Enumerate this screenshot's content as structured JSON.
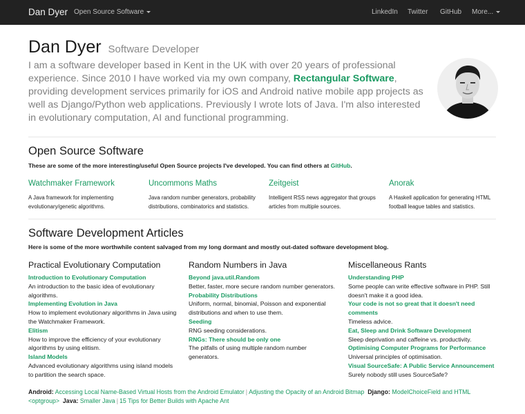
{
  "nav": {
    "brand": "Dan Dyer",
    "dropdown": "Open Source Software",
    "right": [
      "LinkedIn",
      "Twitter",
      "GitHub"
    ],
    "more": "More..."
  },
  "hero": {
    "name": "Dan Dyer",
    "subtitle": "Software Developer",
    "intro_before": "I am a software developer based in Kent in the UK with over 20 years of professional experience. Since 2010 I have worked via my own company, ",
    "intro_company": "Rectangular Software",
    "intro_after": ", providing development services primarily for iOS and Android native mobile app projects as well as Django/Python web applications. Previously I wrote lots of Java. I'm also interested in evolutionary computation, AI and functional programming."
  },
  "oss": {
    "heading": "Open Source Software",
    "lead_before": "These are some of the more interesting/useful Open Source projects I've developed. You can find others at ",
    "lead_link": "GitHub",
    "lead_after": ".",
    "projects": [
      {
        "title": "Watchmaker Framework",
        "desc": "A Java framework for implementing evolutionary/genetic algorithms."
      },
      {
        "title": "Uncommons Maths",
        "desc": "Java random number generators, probability distributions, combinatorics and statistics."
      },
      {
        "title": "Zeitgeist",
        "desc": "Intelligent RSS news aggregator that groups articles from multiple sources."
      },
      {
        "title": "Anorak",
        "desc": "A Haskell application for generating HTML football league tables and statistics."
      }
    ]
  },
  "articles": {
    "heading": "Software Development Articles",
    "lead": "Here is some of the more worthwhile content salvaged from my long dormant and mostly out-dated software development blog.",
    "columns": [
      {
        "title": "Practical Evolutionary Computation",
        "items": [
          {
            "link": "Introduction to Evolutionary Computation",
            "desc": "An introduction to the basic idea of evolutionary algorithms."
          },
          {
            "link": "Implementing Evolution in Java",
            "desc": "How to implement evolutionary algorithms in Java using the Watchmaker Framework."
          },
          {
            "link": "Elitism",
            "desc": "How to improve the efficiency of your evolutionary algorithms by using elitism."
          },
          {
            "link": "Island Models",
            "desc": "Advanced evolutionary algorithms using island models to partition the search space."
          }
        ]
      },
      {
        "title": "Random Numbers in Java",
        "items": [
          {
            "link": "Beyond java.util.Random",
            "desc": "Better, faster, more secure random number generators."
          },
          {
            "link": "Probability Distributions",
            "desc": "Uniform, normal, binomial, Poisson and exponential distributions and when to use them."
          },
          {
            "link": "Seeding",
            "desc": "RNG seeding considerations."
          },
          {
            "link": "RNGs: There should be only one",
            "desc": "The pitfalls of using multiple random number generators."
          }
        ]
      },
      {
        "title": "Miscellaneous Rants",
        "items": [
          {
            "link": "Understanding PHP",
            "desc": "Some people can write effective software in PHP. Still doesn't make it a good idea."
          },
          {
            "link": "Your code is not so great that it doesn't need comments",
            "desc": "Timeless advice."
          },
          {
            "link": "Eat, Sleep and Drink Software Development",
            "desc": "Sleep deprivation and caffeine vs. productivity."
          },
          {
            "link": "Optimising Computer Programs for Performance",
            "desc": "Universal principles of optimisation."
          },
          {
            "link": "Visual SourceSafe: A Public Service Announcement",
            "desc": "Surely nobody still uses SourceSafe?"
          }
        ]
      }
    ]
  },
  "footer": {
    "android_label": "Android:",
    "android_links": [
      "Accessing Local Name-Based Virtual Hosts from the Android Emulator",
      "Adjusting the Opacity of an Android Bitmap"
    ],
    "django_label": "Django:",
    "django_links": [
      "ModelChoiceField and HTML <optgroup>"
    ],
    "java_label": "Java:",
    "java_links": [
      "Smaller Java",
      "15 Tips for Better Builds with Apache Ant"
    ],
    "separator": "|"
  },
  "colors": {
    "accent": "#1a9a62",
    "navbar": "#222222"
  }
}
